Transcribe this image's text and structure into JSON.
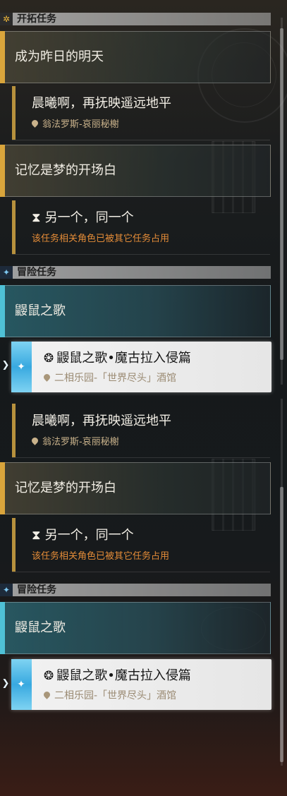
{
  "categories": {
    "trailblaze": {
      "title": "开拓任务",
      "icon": "star-burst-icon"
    },
    "adventure": {
      "title": "冒险任务",
      "icon": "sparkle-icon"
    }
  },
  "top": {
    "chapter1": "成为昨日的明天",
    "quest1": {
      "title": "晨曦啊，再抚映遥远地平",
      "location": "翁法罗斯-哀丽秘榭"
    },
    "chapter2": "记忆是梦的开场白",
    "quest2": {
      "title": "另一个，同一个",
      "warning": "该任务相关角色已被其它任务占用"
    },
    "chapter3": "鼹鼠之歌",
    "selected": {
      "title": "鼹鼠之歌•魔古拉入侵篇",
      "location": "二相乐园-「世界尽头」酒馆"
    }
  },
  "bottom": {
    "quest1": {
      "title": "晨曦啊，再抚映遥远地平",
      "location": "翁法罗斯-哀丽秘榭"
    },
    "chapter2": "记忆是梦的开场白",
    "quest2": {
      "title": "另一个，同一个",
      "warning": "该任务相关角色已被其它任务占用"
    },
    "chapter3": "鼹鼠之歌",
    "selected": {
      "title": "鼹鼠之歌•魔古拉入侵篇",
      "location": "二相乐园-「世界尽头」酒馆"
    }
  },
  "colors": {
    "gold": "#d9a53c",
    "teal": "#4fc1d6",
    "warning": "#e48c38",
    "location": "#c9b28b"
  }
}
